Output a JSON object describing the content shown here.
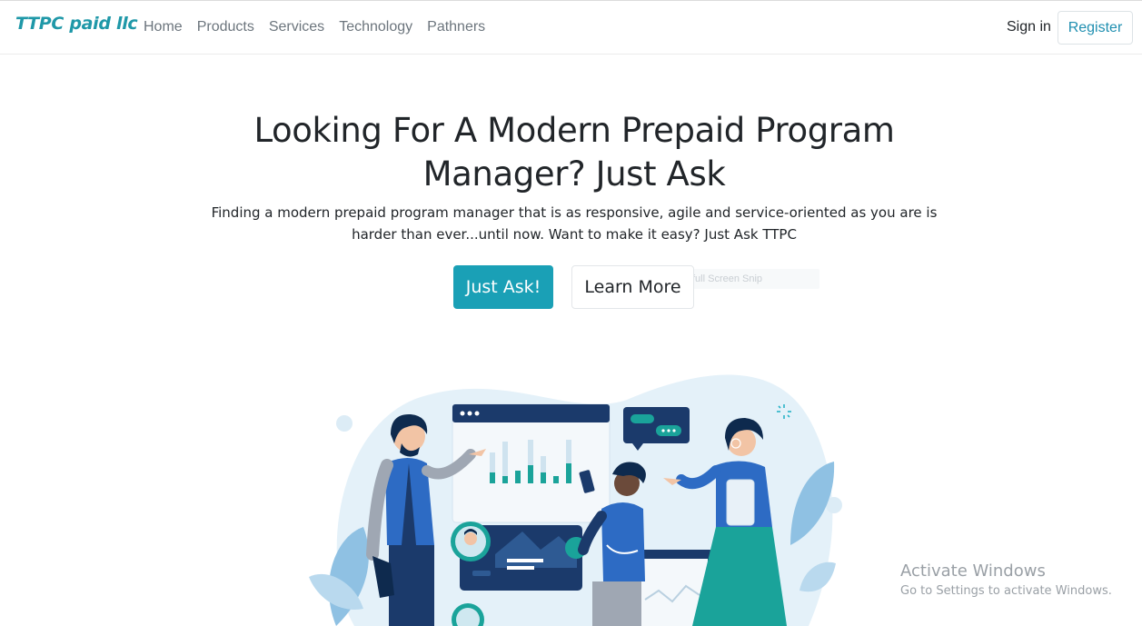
{
  "navbar": {
    "brand": "TTPC paid llc",
    "links": [
      "Home",
      "Products",
      "Services",
      "Technology",
      "Pathners"
    ],
    "sign_in": "Sign in",
    "register": "Register"
  },
  "hero": {
    "title": "Looking For A Modern Prepaid Program Manager? Just Ask",
    "subtitle": "Finding a modern prepaid program manager that is as responsive, agile and service-oriented as you are is harder than ever...until now. Want to make it easy? Just Ask TTPC",
    "primary_button": "Just Ask!",
    "secondary_button": "Learn More",
    "overlay_text": "full Screen Snip"
  },
  "watermark": {
    "line1": "Activate Windows",
    "line2": "Go to Settings to activate Windows."
  },
  "colors": {
    "brand": "#1f98a8",
    "accent": "#1aa0b6",
    "navy": "#1b3a6b",
    "teal": "#1aa39a"
  }
}
